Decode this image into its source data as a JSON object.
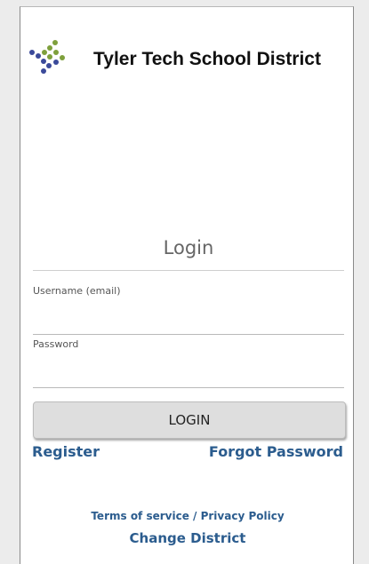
{
  "header": {
    "district_name": "Tyler Tech School District",
    "logo_icon": "dot-grid-logo-icon"
  },
  "login": {
    "title": "Login",
    "username_label": "Username (email)",
    "username_value": "",
    "password_label": "Password",
    "password_value": "",
    "button_label": "LOGIN"
  },
  "links": {
    "register": "Register",
    "forgot_password": "Forgot Password",
    "terms": "Terms of service / Privacy Policy",
    "change_district": "Change District"
  },
  "colors": {
    "page_background": "#ececec",
    "card_background": "#ffffff",
    "link": "#2b5c8e",
    "logo_green": "#7ea03c",
    "logo_blue": "#3b4a9a",
    "button_background": "#dedede"
  }
}
